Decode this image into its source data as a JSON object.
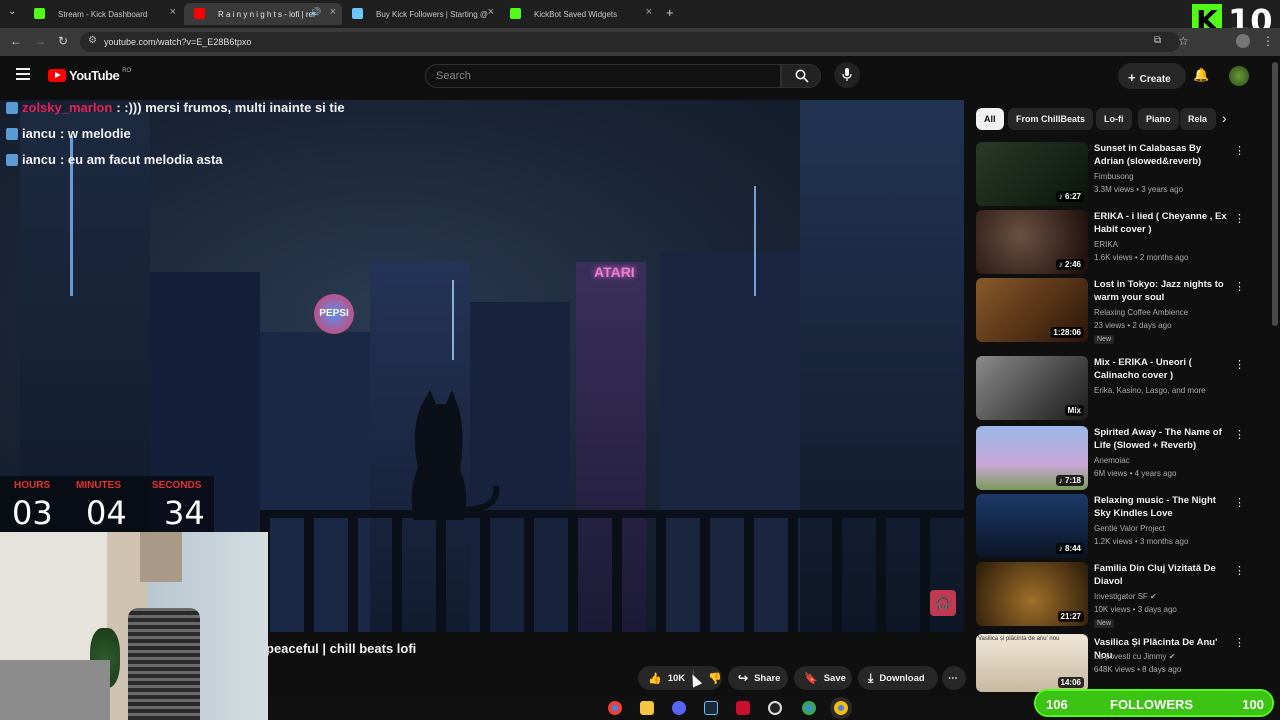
{
  "browser": {
    "tabs": [
      {
        "title": "Stream - Kick Dashboard",
        "favicon_color": "#53fc18"
      },
      {
        "title": "R a i n y n i g h t s - lofi | rel",
        "favicon_color": "#ff0000"
      },
      {
        "title": "Buy Kick Followers | Starting @",
        "favicon_color": "#6ec6ff"
      },
      {
        "title": "KickBot Saved Widgets",
        "favicon_color": "#53fc18"
      }
    ],
    "url": "youtube.com/watch?v=E_E28B6tpxo",
    "new_tab": "+",
    "back": "←",
    "forward": "→",
    "reload": "↻"
  },
  "overlay": {
    "kick_logo": "K",
    "viewer_count": "10"
  },
  "youtube": {
    "logo": "YouTube",
    "region": "RO",
    "search_placeholder": "Search",
    "create_label": "Create"
  },
  "chat": [
    {
      "user": "zolsky_marlon",
      "message": " : :))) mersi frumos, multi inainte si tie",
      "user_color": "#e0245e"
    },
    {
      "user": "iancu",
      "message": " : w melodie",
      "user_color": "#f1f1f1"
    },
    {
      "user": "iancu",
      "message": " : eu am facut melodia asta",
      "user_color": "#f1f1f1"
    }
  ],
  "timer": {
    "hours_label": "HOURS",
    "minutes_label": "MINUTES",
    "seconds_label": "SECONDS",
    "hours": "03",
    "minutes": "04",
    "seconds": "34"
  },
  "video": {
    "sign_pepsi": "PEPSI",
    "sign_atari": "ATARI",
    "title_partial": "peaceful | chill beats lofi"
  },
  "actions": {
    "likes": "10K",
    "share": "Share",
    "save": "Save",
    "download": "Download",
    "more": "⋯"
  },
  "chips": [
    "All",
    "From ChillBeats",
    "Lo-fi",
    "Piano",
    "Rela"
  ],
  "recommendations": [
    {
      "title": "Sunset in Calabasas By Adrian (slowed&reverb)",
      "channel": "Fimbusong",
      "meta": "3.3M views • 3 years ago",
      "duration": "♪ 6:27",
      "badge": "",
      "thumb": "#2a3a2a"
    },
    {
      "title": "ERIKA - i lied ( Cheyanne , Ex Habit cover )",
      "channel": "ERIKA",
      "meta": "1.6K views • 2 months ago",
      "duration": "♪ 2:46",
      "badge": "",
      "thumb": "#3a2020"
    },
    {
      "title": "Lost in Tokyo: Jazz nights to warm your soul",
      "channel": "Relaxing Coffee Ambience",
      "meta": "23 views • 2 days ago",
      "duration": "1:28:06",
      "badge": "New",
      "thumb": "#5a3a1a"
    },
    {
      "title": "Mix - ERIKA - Uneori ( Calinacho cover )",
      "channel": "Erika, Kasino, Lasgo, and more",
      "meta": "",
      "duration": "Mix",
      "badge": "",
      "thumb": "#555555"
    },
    {
      "title": "Spirited Away - The Name of Life (Slowed + Reverb)",
      "channel": "Anemoiac",
      "meta": "6M views • 4 years ago",
      "duration": "♪ 7:18",
      "badge": "",
      "thumb": "#8aa6d8"
    },
    {
      "title": "Relaxing music - The Night Sky Kindles Love",
      "channel": "Gentle Valor Project",
      "meta": "1.2K views • 3 months ago",
      "duration": "♪ 8:44",
      "badge": "",
      "thumb": "#1c3a5a"
    },
    {
      "title": "Familia Din Cluj Vizitată De Diavol",
      "channel": "Investigator SF ✔",
      "meta": "10K views • 3 days ago",
      "duration": "21:27",
      "badge": "New",
      "thumb": "#5a4020"
    },
    {
      "title": "Vasilica Și Plăcinta De Anu' Nou",
      "channel": "La povesti cu Jimmy ✔",
      "meta": "648K views • 8 days ago",
      "duration": "14:06",
      "badge": "",
      "thumb": "#d8d0c0"
    }
  ],
  "followers": {
    "current": "106",
    "label": "FOLLOWERS",
    "goal": "100",
    "progress": 1.0,
    "color": "#53fc18"
  },
  "webcam": {
    "thumb_caption": "Vasilica și plăcinta de anu' nou"
  }
}
